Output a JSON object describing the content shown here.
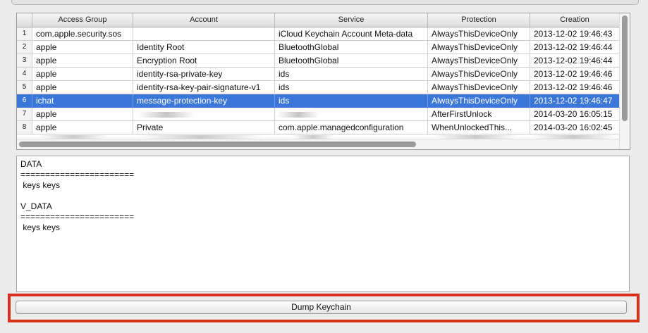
{
  "table": {
    "columns": [
      "",
      "Access Group",
      "Account",
      "Service",
      "Protection",
      "Creation"
    ],
    "rows": [
      {
        "num": "1",
        "access_group": "com.apple.security.sos",
        "account": "",
        "service": "iCloud Keychain Account Meta-data",
        "protection": "AlwaysThisDeviceOnly",
        "creation": "2013-12-02 19:46:43"
      },
      {
        "num": "2",
        "access_group": "apple",
        "account": "Identity Root",
        "service": "BluetoothGlobal",
        "protection": "AlwaysThisDeviceOnly",
        "creation": "2013-12-02 19:46:44"
      },
      {
        "num": "3",
        "access_group": "apple",
        "account": "Encryption Root",
        "service": "BluetoothGlobal",
        "protection": "AlwaysThisDeviceOnly",
        "creation": "2013-12-02 19:46:44"
      },
      {
        "num": "4",
        "access_group": "apple",
        "account": "identity-rsa-private-key",
        "service": "ids",
        "protection": "AlwaysThisDeviceOnly",
        "creation": "2013-12-02 19:46:46"
      },
      {
        "num": "5",
        "access_group": "apple",
        "account": "identity-rsa-key-pair-signature-v1",
        "service": "ids",
        "protection": "AlwaysThisDeviceOnly",
        "creation": "2013-12-02 19:46:46"
      },
      {
        "num": "6",
        "access_group": "ichat",
        "account": "message-protection-key",
        "service": "ids",
        "protection": "AlwaysThisDeviceOnly",
        "creation": "2013-12-02 19:46:47"
      },
      {
        "num": "7",
        "access_group": "apple",
        "account": "",
        "service": "",
        "protection": "AfterFirstUnlock",
        "creation": "2014-03-20 16:05:15"
      },
      {
        "num": "8",
        "access_group": "apple",
        "account": "Private",
        "service": "com.apple.managedconfiguration",
        "protection": "WhenUnlockedThis...",
        "creation": "2014-03-20 16:02:45"
      }
    ],
    "selected_row": 6,
    "colors": {
      "selection": "#3b77d8",
      "selection_text": "#ffffff"
    }
  },
  "data_panel": {
    "text": "DATA\n=======================\n keys keys\n\nV_DATA\n=======================\n keys keys"
  },
  "dump_button": {
    "label": "Dump Keychain"
  },
  "highlight": {
    "color": "#d9301c"
  }
}
